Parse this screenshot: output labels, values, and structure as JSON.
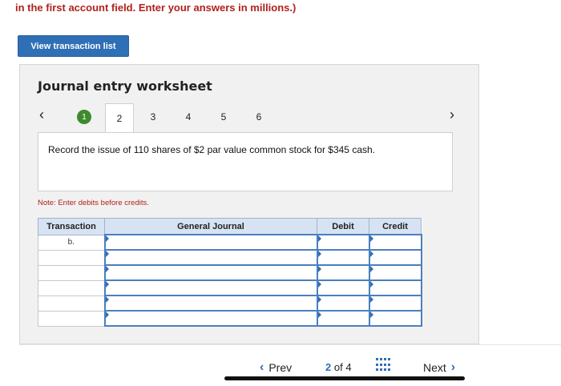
{
  "instruction": "in the first account field. Enter your answers in millions.)",
  "view_button": "View transaction list",
  "worksheet": {
    "title": "Journal entry worksheet",
    "steps": [
      "1",
      "2",
      "3",
      "4",
      "5",
      "6"
    ],
    "description": "Record the issue of 110 shares of $2 par value common stock for $345 cash.",
    "note": "Note: Enter debits before credits."
  },
  "table": {
    "headers": [
      "Transaction",
      "General Journal",
      "Debit",
      "Credit"
    ],
    "rows": [
      {
        "transaction": "b."
      },
      {
        "transaction": ""
      },
      {
        "transaction": ""
      },
      {
        "transaction": ""
      },
      {
        "transaction": ""
      },
      {
        "transaction": ""
      }
    ]
  },
  "footer": {
    "prev": "Prev",
    "next": "Next",
    "current": "2",
    "of_label": "of 4"
  },
  "colors": {
    "accent": "#2f6fb6",
    "warning_text": "#b0221d",
    "completed_step": "#3f8a2f"
  }
}
